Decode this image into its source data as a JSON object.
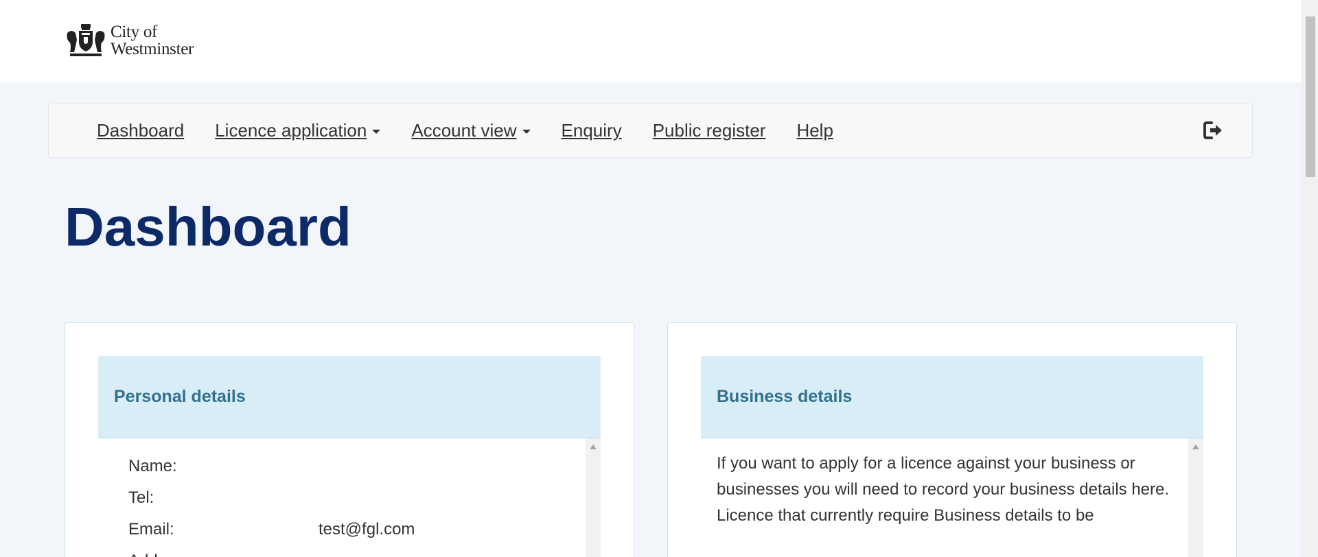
{
  "header": {
    "logo_line1": "City of",
    "logo_line2": "Westminster"
  },
  "nav": {
    "items": [
      {
        "label": "Dashboard",
        "dropdown": false
      },
      {
        "label": "Licence application",
        "dropdown": true
      },
      {
        "label": "Account view",
        "dropdown": true
      },
      {
        "label": "Enquiry",
        "dropdown": false
      },
      {
        "label": "Public register",
        "dropdown": false
      },
      {
        "label": "Help",
        "dropdown": false
      }
    ],
    "logout_icon": "sign-out-icon"
  },
  "page": {
    "title": "Dashboard"
  },
  "personal": {
    "title": "Personal details",
    "name_label": "Name:",
    "name_value": "",
    "tel_label": "Tel:",
    "tel_value": "",
    "email_label": "Email:",
    "email_value": "test@fgl.com",
    "address_label": "Address:"
  },
  "business": {
    "title": "Business details",
    "paragraph1": "If you want to apply for a licence against your business or businesses you will need to record your business details here.",
    "paragraph2": "Licence that currently require Business details to be"
  },
  "colors": {
    "title_blue": "#0d2a68",
    "panel_heading_bg": "#d9edf6",
    "panel_heading_text": "#31708f",
    "page_bg": "#f2f6fa"
  }
}
